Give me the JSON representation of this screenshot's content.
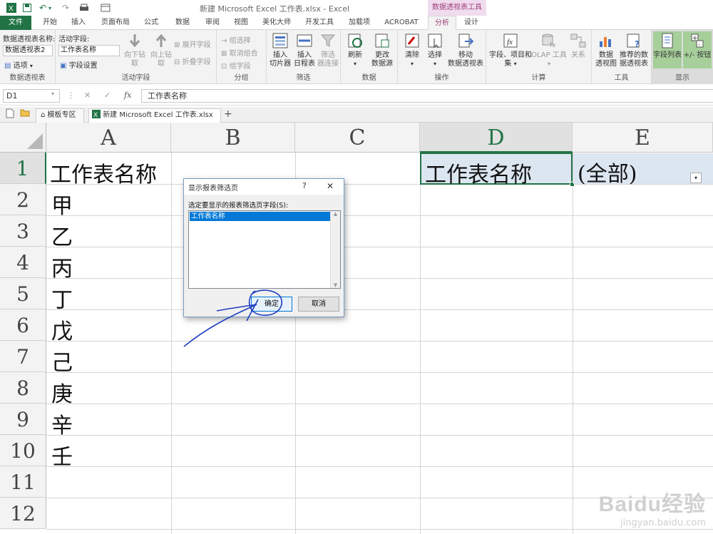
{
  "window": {
    "title": "新建 Microsoft Excel 工作表.xlsx - Excel",
    "context_tools": "数据透视表工具"
  },
  "tabs": [
    "文件",
    "开始",
    "插入",
    "页面布局",
    "公式",
    "数据",
    "审阅",
    "视图",
    "美化大师",
    "开发工具",
    "加载项",
    "ACROBAT",
    "分析",
    "设计"
  ],
  "active_tab": "分析",
  "ribbon": {
    "pivot_name_label": "数据透视表名称:",
    "pivot_name_value": "数据透视表2",
    "options": "选项",
    "group_pivot": "数据透视表",
    "active_field_label": "活动字段:",
    "active_field_value": "工作表名称",
    "field_settings": "字段设置",
    "drill_down": "向下钻取",
    "drill_up": "向上钻",
    "drill_up_2": "取",
    "expand_field": "展开字段",
    "collapse_field": "折叠字段",
    "group_active_field": "活动字段",
    "group_selection": "组选择",
    "ungroup": "取消组合",
    "group_field": "组字段",
    "group_group": "分组",
    "insert_slicer": [
      "插入",
      "切片器"
    ],
    "insert_timeline": [
      "插入",
      "日程表"
    ],
    "filter_connections": [
      "筛选",
      "器连接"
    ],
    "group_filter": "筛选",
    "refresh": "刷新",
    "change_source": [
      "更改",
      "数据源"
    ],
    "group_data": "数据",
    "clear": "清除",
    "select": "选择",
    "move_pivot": [
      "移动",
      "数据透视表"
    ],
    "group_actions": "操作",
    "fields_items_sets": [
      "字段、项目和",
      "集"
    ],
    "olap_tools": "OLAP 工具",
    "relationships": "关系",
    "group_calc": "计算",
    "pivot_chart": [
      "数据",
      "透视图"
    ],
    "recommended_pivot": [
      "推荐的数",
      "据透视表"
    ],
    "group_tools": "工具",
    "field_list": "字段列表",
    "plus_minus_buttons": "+/- 按钮",
    "group_show": "显示"
  },
  "formula_bar": {
    "name_box": "D1",
    "content": "工作表名称",
    "fx": "fx"
  },
  "workbook_tabs": {
    "template": "模板专区",
    "file": "新建 Microsoft Excel 工作表.xlsx",
    "add": "+"
  },
  "sheet": {
    "columns": [
      "A",
      "B",
      "C",
      "D",
      "E"
    ],
    "rows": [
      "1",
      "2",
      "3",
      "4",
      "5",
      "6",
      "7",
      "8",
      "9",
      "10",
      "11",
      "12"
    ],
    "col_a": [
      "工作表名称",
      "甲",
      "乙",
      "丙",
      "丁",
      "戊",
      "己",
      "庚",
      "辛",
      "壬"
    ],
    "d1": "工作表名称",
    "e1": "(全部)"
  },
  "dialog": {
    "title": "显示报表筛选页",
    "help": "?",
    "close": "✕",
    "prompt": "选定要显示的报表筛选页字段(S):",
    "items": [
      "工作表名称"
    ],
    "ok": "确定",
    "cancel": "取消"
  },
  "watermark": {
    "brand": "Baidu经验",
    "url": "jingyan.baidu.com"
  },
  "colors": {
    "excel_green": "#217346",
    "context_tab": "#a0417c",
    "selection_blue": "#0078d7",
    "annotation_ink": "#1f3fbf"
  }
}
